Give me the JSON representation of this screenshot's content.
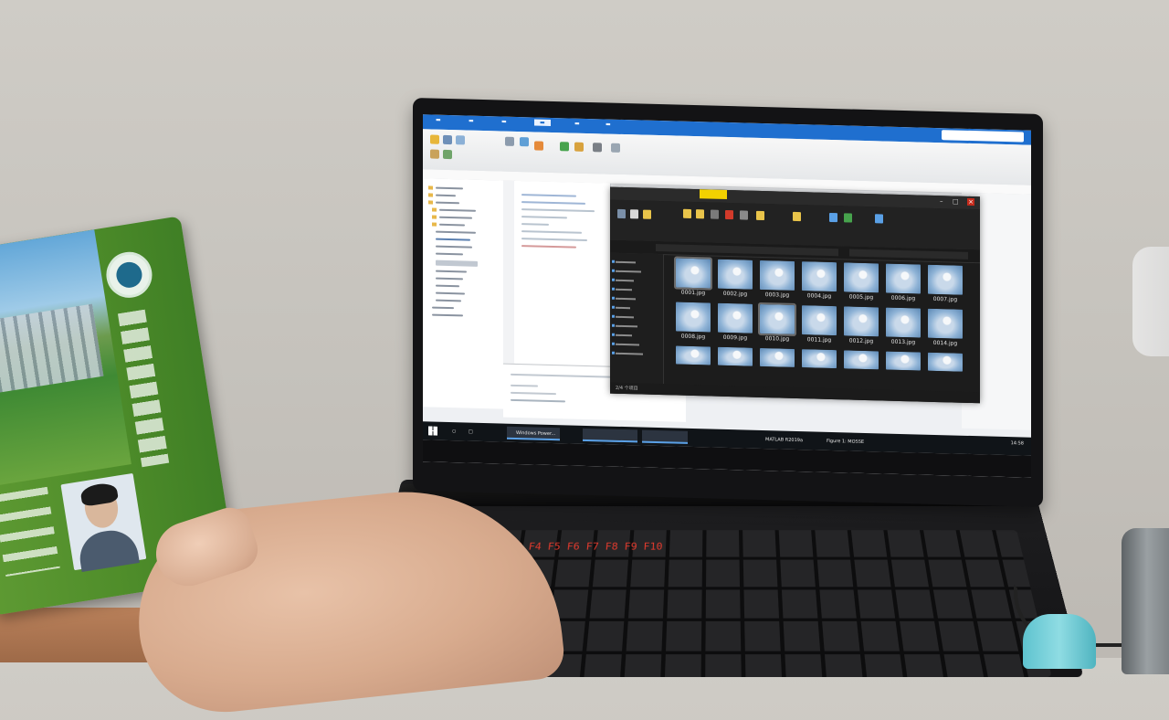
{
  "scene": {
    "description_type": "photo of laptop screen with ID card held in hand",
    "colors": {
      "wall": "#c8c5bf",
      "card_green": "#4f8d2a",
      "screen_accent": "#1f6fcf",
      "explorer_dark": "#1c1c1c",
      "keyboard_backlight": "#e23b2e"
    }
  },
  "explorer": {
    "status": "2/4 个项目",
    "thumbnails": [
      "0001.jpg",
      "0002.jpg",
      "0003.jpg",
      "0004.jpg",
      "0005.jpg",
      "0006.jpg",
      "0007.jpg",
      "0008.jpg",
      "0009.jpg",
      "0010.jpg",
      "0011.jpg",
      "0012.jpg",
      "0013.jpg",
      "0014.jpg"
    ]
  },
  "taskbar": {
    "items": [
      "Windows Power...",
      "MATLAB R2019a",
      "Figure 1: MOSSE"
    ],
    "time": "14:58"
  }
}
